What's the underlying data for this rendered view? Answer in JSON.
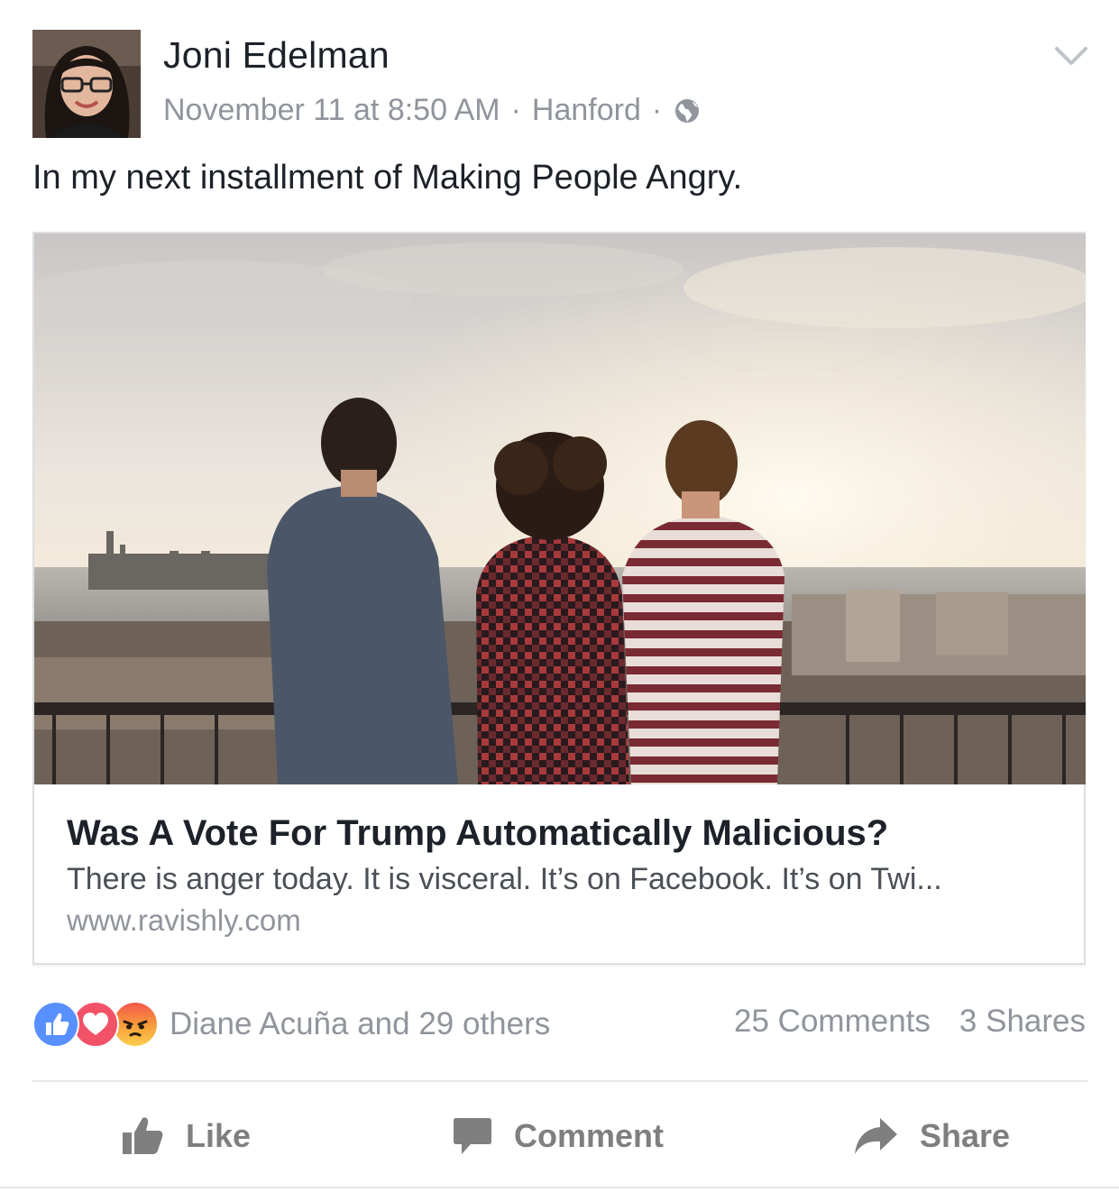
{
  "post": {
    "author": "Joni Edelman",
    "date": "November 11 at 8:50 AM",
    "location": "Hanford",
    "separator": "·",
    "audience_icon": "globe-icon",
    "menu_icon": "chevron-down-icon",
    "text": "In my next installment of Making People Angry."
  },
  "link": {
    "title": "Was A Vote For Trump Automatically Malicious?",
    "description": "There is anger today. It is visceral. It’s on Facebook. It’s on Twi...",
    "url": "www.ravishly.com"
  },
  "reactions": {
    "icons": [
      "like-reaction-icon",
      "love-reaction-icon",
      "angry-reaction-icon"
    ],
    "summary": "Diane Acuña and 29 others",
    "comments": "25 Comments",
    "shares": "3 Shares"
  },
  "actions": {
    "like": "Like",
    "comment": "Comment",
    "share": "Share"
  },
  "colors": {
    "name": "#1d2129",
    "meta": "#90949c",
    "like_blue": "#5890ff",
    "love_red": "#f25268",
    "action_gray": "#7f7f7f"
  }
}
